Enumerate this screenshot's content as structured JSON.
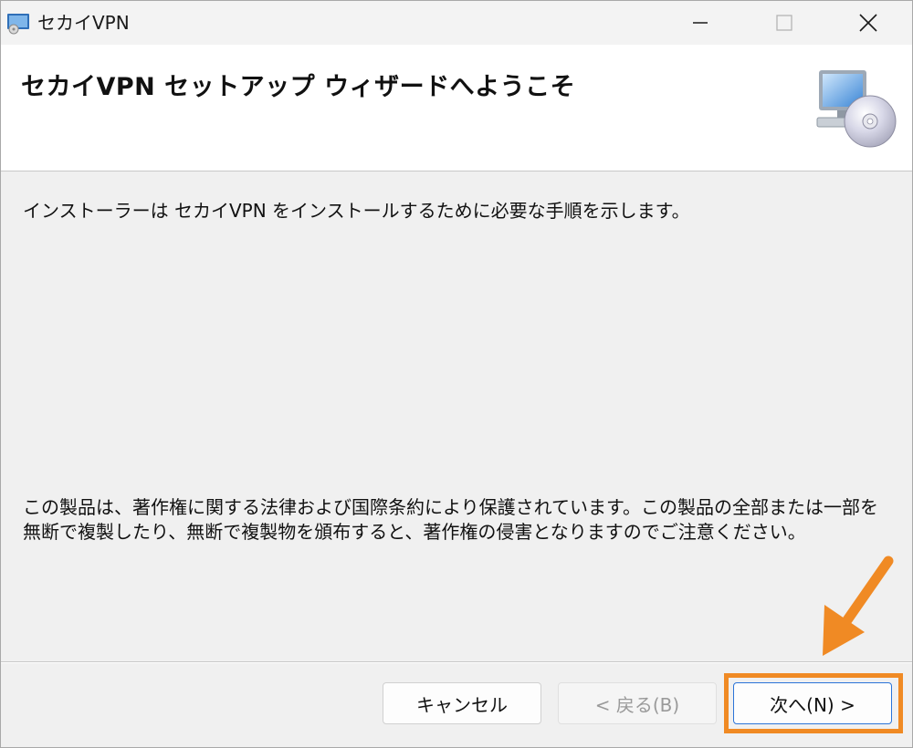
{
  "window": {
    "title": "セカイVPN",
    "app_icon": "installer-app-icon"
  },
  "titlebar_controls": {
    "minimize_icon": "minimize-icon",
    "maximize_icon": "maximize-icon",
    "close_icon": "close-icon"
  },
  "banner": {
    "title": "セカイVPN セットアップ ウィザードへようこそ",
    "icon": "computer-cd-icon"
  },
  "body": {
    "intro": "インストーラーは セカイVPN をインストールするために必要な手順を示します。",
    "copyright": "この製品は、著作権に関する法律および国際条約により保護されています。この製品の全部または一部を無断で複製したり、無断で複製物を頒布すると、著作権の侵害となりますのでご注意ください。"
  },
  "buttons": {
    "cancel": "キャンセル",
    "back": "< 戻る(B)",
    "next": "次へ(N) >"
  },
  "annotation": {
    "color": "#f08a24",
    "arrow_icon": "orange-arrow-icon"
  }
}
